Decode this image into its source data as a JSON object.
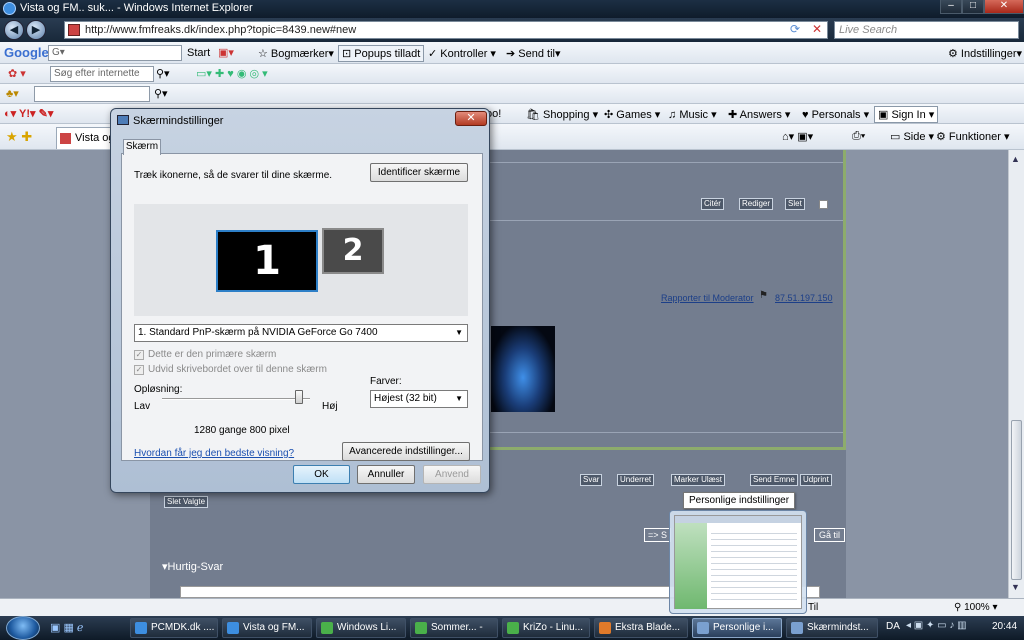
{
  "window": {
    "title": "Vista og FM.. suk... - Windows Internet Explorer"
  },
  "address": {
    "url": "http://www.fmfreaks.dk/index.php?topic=8439.new#new",
    "search_placeholder": "Live Search"
  },
  "google_bar": {
    "logo": "Google",
    "search_value": "G▾",
    "items": [
      "Start",
      "Bogmærker▾",
      "Popups tilladt",
      "Kontroller ▾",
      "Send til▾",
      "Indstillinger▾"
    ]
  },
  "search_bar": {
    "placeholder": "Søg efter internette"
  },
  "yahoo_bar": {
    "items": [
      "oo!",
      "Shopping ▾",
      "Games ▾",
      "Music ▾",
      "Answers ▾",
      "Personals ▾",
      "Sign In"
    ]
  },
  "tabs_bar": {
    "tab_label": "Vista og",
    "right_items": [
      "Side ▾",
      "Funktioner ▾"
    ]
  },
  "page": {
    "post_buttons": [
      "Citér",
      "Rediger",
      "Slet"
    ],
    "report_link": "Rapporter til Moderator",
    "ip_link": "87.51.197.150",
    "action_buttons": [
      "Svar",
      "Underret",
      "Marker Ulæst",
      "Send Emne",
      "Udprint"
    ],
    "delete_selected": "Slet Valgte",
    "goto_label": "Gå til",
    "nav_fragment": "=> S",
    "quick_reply": "Hurtig-Svar",
    "status_right": "Til",
    "zoom": "100%"
  },
  "dialog": {
    "title": "Skærmindstillinger",
    "close": "x",
    "tab": "Skærm",
    "instruction": "Træk ikonerne, så de svarer til dine skærme.",
    "identify_button": "Identificer skærme",
    "monitor1": "1",
    "monitor2": "2",
    "display_select": "1. Standard PnP-skærm på NVIDIA GeForce Go 7400",
    "primary_checkbox": "Dette er den primære skærm",
    "extend_checkbox": "Udvid skrivebordet over til denne skærm",
    "resolution_label": "Opløsning:",
    "low_label": "Lav",
    "high_label": "Høj",
    "resolution_value": "1280 gange 800 pixel",
    "resolution_slider_fraction": 0.95,
    "colors_label": "Farver:",
    "colors_value": "Højest (32 bit)",
    "help_link": "Hvordan får jeg den bedste visning?",
    "advanced_button": "Avancerede indstillinger...",
    "ok": "OK",
    "cancel": "Annuller",
    "apply": "Anvend"
  },
  "taskbar": {
    "tasks": [
      "PCMDK.dk ....",
      "Vista og FM...",
      "Windows Li...",
      "Sommer... -",
      "KriZo - Linu...",
      "Ekstra Blade...",
      "Personlige i...",
      "Skærmindst..."
    ],
    "lang": "DA",
    "time": "20:44",
    "tooltip": "Personlige indstillinger"
  }
}
